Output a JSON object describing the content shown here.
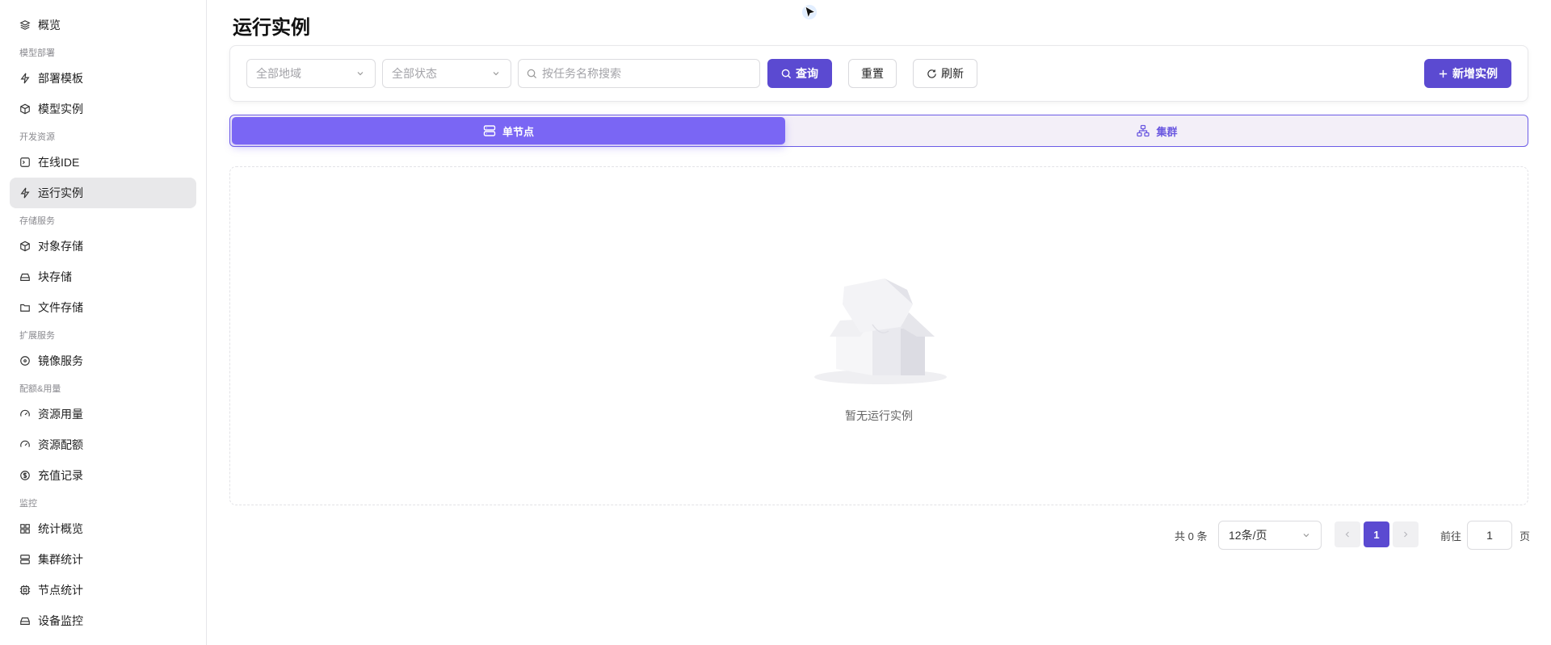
{
  "sidebar": {
    "overview": {
      "label": "概览",
      "icon": "layers-icon"
    },
    "groups": [
      {
        "title": "模型部署",
        "items": [
          {
            "label": "部署模板",
            "icon": "bolt-icon"
          },
          {
            "label": "模型实例",
            "icon": "cube-icon"
          }
        ]
      },
      {
        "title": "开发资源",
        "items": [
          {
            "label": "在线IDE",
            "icon": "terminal-icon"
          },
          {
            "label": "运行实例",
            "icon": "bolt-icon",
            "active": true
          }
        ]
      },
      {
        "title": "存储服务",
        "items": [
          {
            "label": "对象存储",
            "icon": "box-icon"
          },
          {
            "label": "块存储",
            "icon": "hard-drive-icon"
          },
          {
            "label": "文件存储",
            "icon": "folder-icon"
          }
        ]
      },
      {
        "title": "扩展服务",
        "items": [
          {
            "label": "镜像服务",
            "icon": "disc-icon"
          }
        ]
      },
      {
        "title": "配额&用量",
        "items": [
          {
            "label": "资源用量",
            "icon": "gauge-icon"
          },
          {
            "label": "资源配额",
            "icon": "gauge-icon"
          },
          {
            "label": "充值记录",
            "icon": "dollar-circle-icon"
          }
        ]
      },
      {
        "title": "监控",
        "items": [
          {
            "label": "统计概览",
            "icon": "grid-icon"
          },
          {
            "label": "集群统计",
            "icon": "server-icon"
          },
          {
            "label": "节点统计",
            "icon": "cpu-icon"
          },
          {
            "label": "设备监控",
            "icon": "hard-drive-icon"
          }
        ]
      }
    ]
  },
  "main": {
    "title": "运行实例",
    "filters": {
      "region_placeholder": "全部地域",
      "status_placeholder": "全部状态",
      "search_placeholder": "按任务名称搜索",
      "query_label": "查询",
      "reset_label": "重置",
      "refresh_label": "刷新",
      "create_label": "新增实例"
    },
    "tabs": [
      {
        "label": "单节点",
        "icon": "server-icon",
        "active": true
      },
      {
        "label": "集群",
        "icon": "network-icon",
        "active": false
      }
    ],
    "empty_text": "暂无运行实例",
    "pagination": {
      "total_label": "共 0 条",
      "page_size": "12条/页",
      "current_page": "1",
      "goto_prefix": "前往",
      "goto_value": "1",
      "goto_suffix": "页"
    }
  },
  "colors": {
    "accent": "#5b4ad1",
    "tab_active": "#7a66f4",
    "tab_bg": "#f3eff8"
  }
}
